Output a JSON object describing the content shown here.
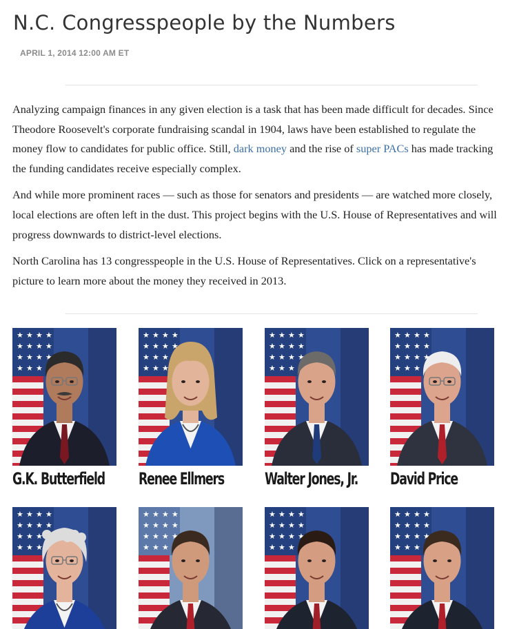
{
  "article": {
    "title": "N.C. Congresspeople by the Numbers",
    "dateline": "APRIL 1, 2014 12:00 AM ET"
  },
  "paragraphs": {
    "p1": {
      "before_link1": "Analyzing campaign finances in any given election is a task that has been made difficult for decades. Since Theodore Roosevelt's corporate fundraising scandal in 1904, laws have been established to regulate the money flow to candidates for public office. Still, ",
      "link1": "dark money",
      "between_links": " and the rise of ",
      "link2": "super PACs",
      "after_link2": " has made tracking the funding candidates receive especially complex."
    },
    "p2": "And while more prominent races — such as those for senators and presidents — are watched more closely, local elections are often left in the dust. This project begins with the U.S. House of Representatives and will progress downwards to district-level elections.",
    "p3": "North Carolina has 13 congresspeople in the U.S. House of Representatives. Click on a representative's picture to learn more about the money they received in 2013."
  },
  "representatives": [
    {
      "name": "G.K. Butterfield",
      "background": "flag",
      "skin": "#b07a5c",
      "hair": "#2b2b2b",
      "hair_style": "short",
      "suit": "#1c1f2b",
      "tie": "#7a1822",
      "glasses": true,
      "mustache": true
    },
    {
      "name": "Renee Ellmers",
      "background": "flag",
      "skin": "#e2b59a",
      "hair": "#c9a56b",
      "hair_style": "long",
      "suit": "#1d4fb5",
      "tie": "",
      "glasses": false,
      "mustache": false
    },
    {
      "name": "Walter Jones, Jr.",
      "background": "flag-blue",
      "skin": "#d9a38a",
      "hair": "#6d6a6a",
      "hair_style": "short",
      "suit": "#2a2d3a",
      "tie": "#1f3b7a",
      "glasses": false,
      "mustache": false
    },
    {
      "name": "David Price",
      "background": "flag",
      "skin": "#dca48c",
      "hair": "#eeeeee",
      "hair_style": "short",
      "suit": "#2f3340",
      "tie": "#b0202a",
      "glasses": true,
      "mustache": false
    },
    {
      "name": "",
      "background": "flag-blue",
      "skin": "#e3b39c",
      "hair": "#dcdcdc",
      "hair_style": "curly",
      "suit": "#1d3f9a",
      "tie": "",
      "glasses": true,
      "mustache": false
    },
    {
      "name": "",
      "background": "flag-pale",
      "skin": "#cf9a7c",
      "hair": "#3a2a20",
      "hair_style": "short",
      "suit": "#262833",
      "tie": "#b0202a",
      "glasses": false,
      "mustache": false
    },
    {
      "name": "",
      "background": "flag",
      "skin": "#d49c80",
      "hair": "#2a1c14",
      "hair_style": "short",
      "suit": "#1e2330",
      "tie": "#a01f28",
      "glasses": false,
      "mustache": false
    },
    {
      "name": "",
      "background": "flag",
      "skin": "#d8a185",
      "hair": "#3b2a1e",
      "hair_style": "short",
      "suit": "#1e2330",
      "tie": "#b0202a",
      "glasses": false,
      "mustache": false
    }
  ]
}
